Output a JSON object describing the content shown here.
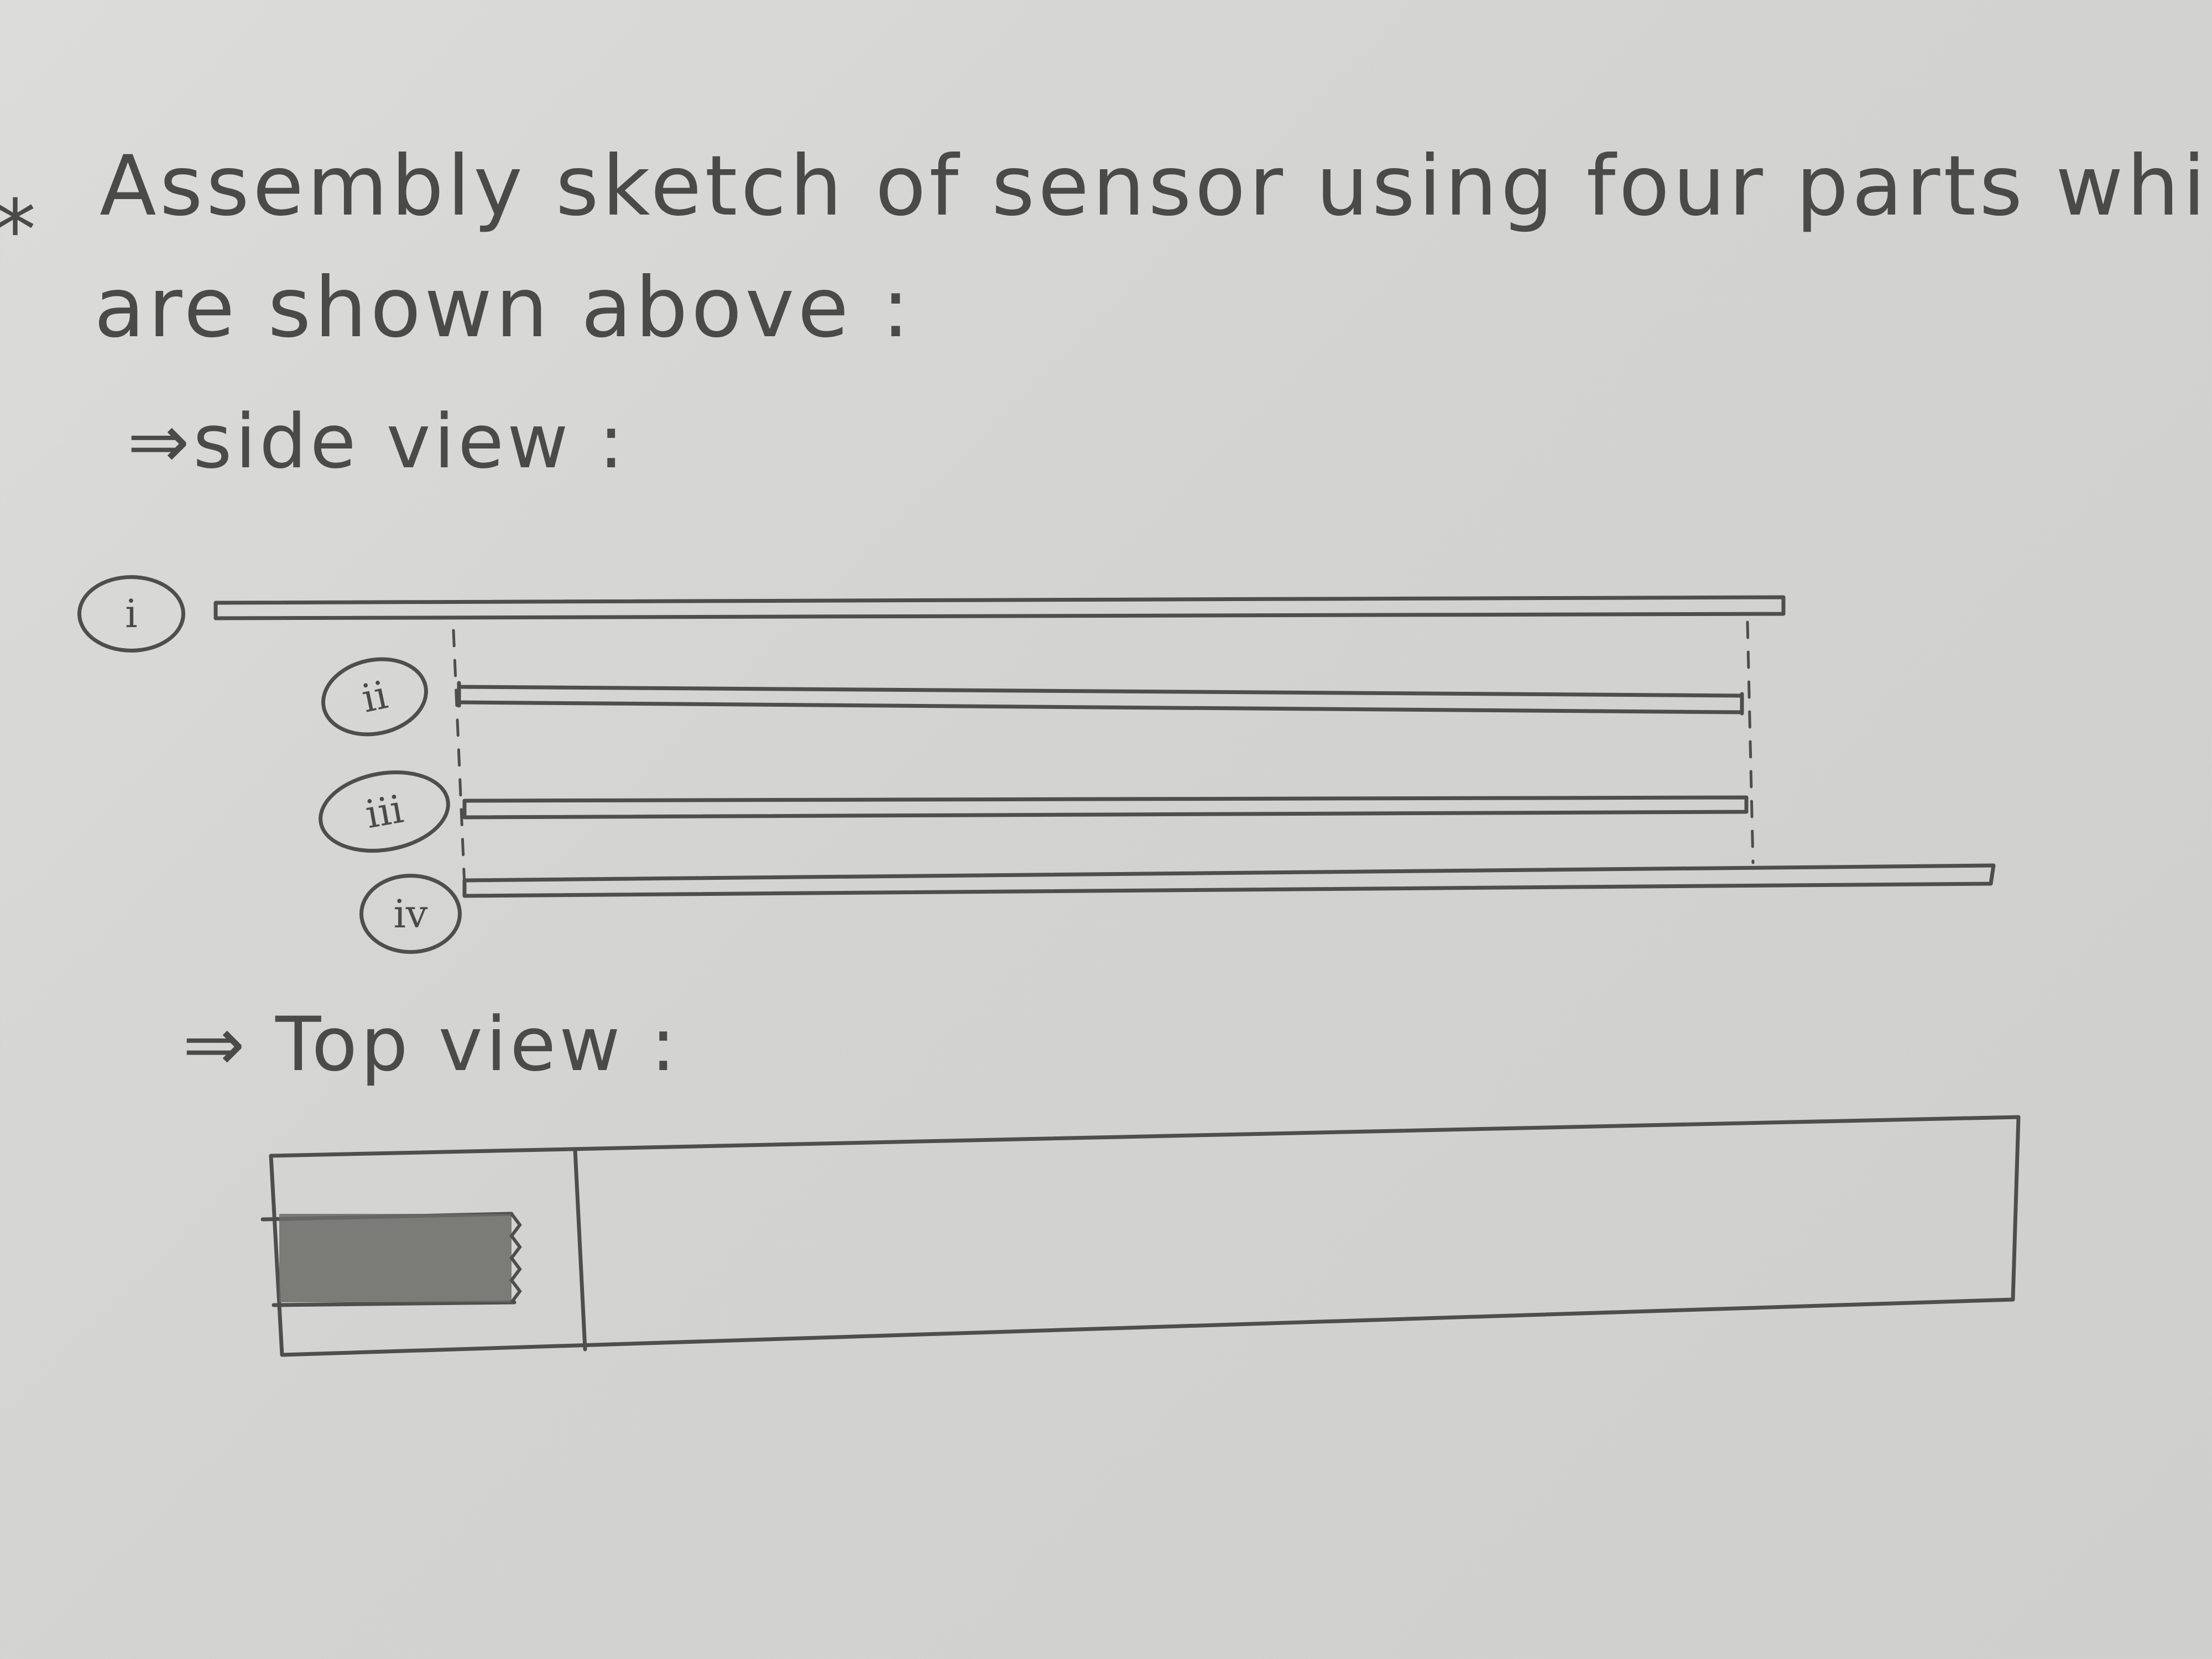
{
  "title": {
    "bullet": "*",
    "line1": "Assembly sketch of sensor using four parts which",
    "line2": "are shown above :"
  },
  "side_view": {
    "heading": "⇒side view :",
    "parts": [
      {
        "label": "i"
      },
      {
        "label": "ii"
      },
      {
        "label": "iii"
      },
      {
        "label": "iv"
      }
    ]
  },
  "top_view": {
    "heading": "⇒ Top view :"
  },
  "colors": {
    "paper": "#d3d3d1",
    "pencil": "#4e4e4c",
    "shading": "#6b6b69"
  }
}
